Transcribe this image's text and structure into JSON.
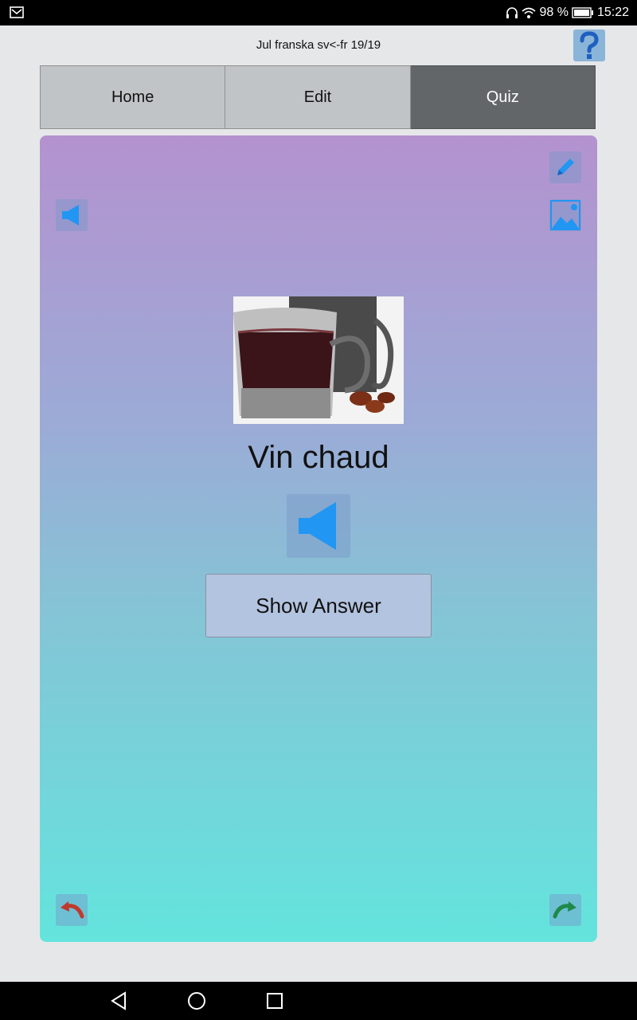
{
  "status_bar": {
    "battery_percent": "98 %",
    "time": "15:22",
    "icons": [
      "notification-icon",
      "headphones-icon",
      "wifi-icon",
      "battery-icon"
    ]
  },
  "header": {
    "title": "Jul franska sv<-fr 19/19",
    "help_icon": "question-mark-icon"
  },
  "tabs": [
    {
      "label": "Home",
      "active": false
    },
    {
      "label": "Edit",
      "active": false
    },
    {
      "label": "Quiz",
      "active": true
    }
  ],
  "card": {
    "word": "Vin chaud",
    "show_answer_label": "Show Answer",
    "icons": {
      "top_left": "speaker-icon",
      "top_right_1": "pencil-icon",
      "top_right_2": "image-icon",
      "center": "speaker-icon",
      "bottom_left": "back-arrow-icon",
      "bottom_right": "forward-arrow-icon"
    }
  },
  "colors": {
    "gradient_top": "#b492cf",
    "gradient_bottom": "#63e4dd",
    "active_tab": "#626668",
    "icon_blue": "#2196f3",
    "back_arrow": "#c0392b",
    "forward_arrow": "#1e8a4a"
  },
  "nav_bar": {
    "buttons": [
      "back-triangle-icon",
      "home-circle-icon",
      "recents-square-icon"
    ]
  }
}
